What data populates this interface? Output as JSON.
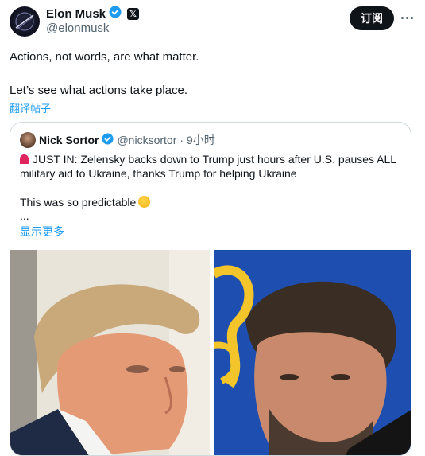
{
  "post": {
    "author_name": "Elon Musk",
    "author_handle": "@elonmusk",
    "subscribe_label": "订阅",
    "text_line1": "Actions, not words, are what matter.",
    "text_line2": "Let’s see what actions take place.",
    "translate_label": "翻译帖子"
  },
  "quoted": {
    "author_name": "Nick Sortor",
    "author_handle": "@nicksortor",
    "time": "· 9小时",
    "line1": "JUST IN: Zelensky backs down to Trump just hours after U.S. pauses ALL",
    "line2": "military aid to Ukraine, thanks Trump for helping Ukraine",
    "line3": "This was so predictable",
    "ellipsis": "...",
    "show_more_label": "显示更多"
  },
  "icons": {
    "verified": "verified-badge-icon",
    "x_logo": "x-logo-icon",
    "more": "more-icon",
    "siren": "siren-emoji-icon",
    "laugh": "rolling-laughing-emoji-icon"
  },
  "colors": {
    "accent": "#1d9bf0",
    "text": "#0f1419",
    "muted": "#536471",
    "border": "#cfd9de"
  }
}
